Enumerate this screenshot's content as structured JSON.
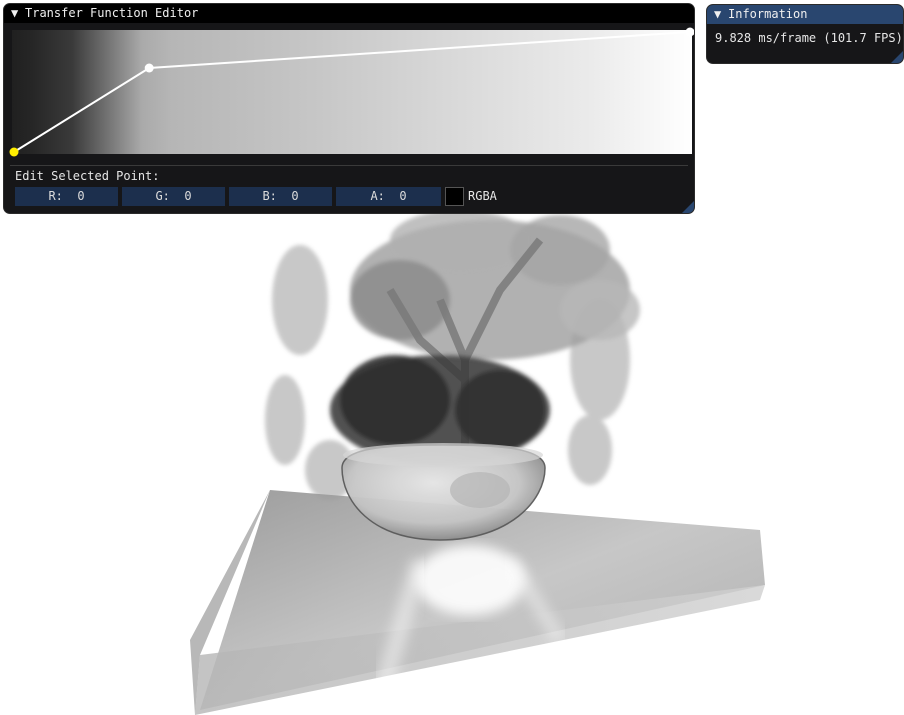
{
  "transfer_function_editor": {
    "title": "Transfer Function Editor",
    "points": [
      {
        "value": 0.0,
        "opacity": 0.0,
        "selected": true
      },
      {
        "value": 0.2,
        "opacity": 0.7
      },
      {
        "value": 1.0,
        "opacity": 1.0
      }
    ],
    "edit_label": "Edit Selected Point:",
    "fields": {
      "r": "R:  0",
      "g": "G:  0",
      "b": "B:  0",
      "a": "A:  0"
    },
    "swatch_color": "#000000",
    "rgba_label": "RGBA"
  },
  "information": {
    "title": "Information",
    "frame_time": "9.828 ms/frame (101.7 FPS)"
  },
  "colors": {
    "accent": "#29466f",
    "field_bg": "#1c2f4d",
    "selected_point": "#ffee00",
    "window_bg": "#161618"
  },
  "icons": {
    "collapse": "triangle-down-icon",
    "resize": "resize-grip-icon"
  }
}
